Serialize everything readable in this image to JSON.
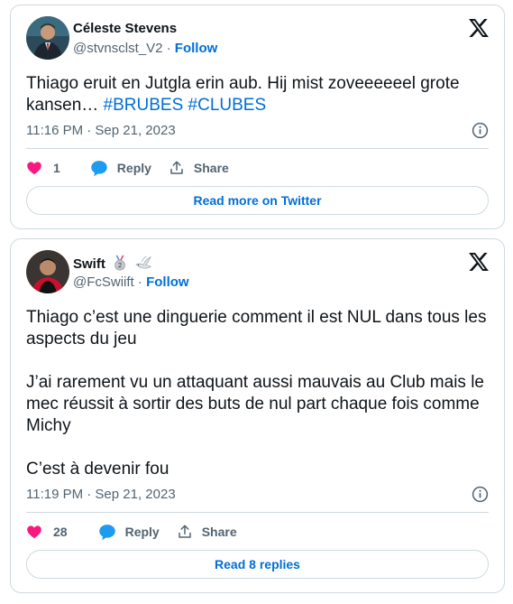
{
  "tweets": [
    {
      "author_name": "Céleste Stevens",
      "handle": "@stvnsclst_V2",
      "separator": "·",
      "follow_label": "Follow",
      "text_plain": "Thiago eruit en Jutgla erin aub. Hij mist zoveeeeeel grote kansen… ",
      "hashtags": [
        "#BRUBES",
        "#CLUBES"
      ],
      "timestamp": "11:16 PM · Sep 21, 2023",
      "likes": "1",
      "reply_label": "Reply",
      "share_label": "Share",
      "cta_label": "Read more on Twitter"
    },
    {
      "author_name": "Swift",
      "handle": "@FcSwiift",
      "separator": "·",
      "follow_label": "Follow",
      "paragraphs": [
        "Thiago c’est une dinguerie comment il est NUL dans tous les aspects du jeu",
        "J’ai rarement vu un attaquant aussi mauvais au Club mais le mec réussit à sortir des buts de nul part chaque fois comme Michy",
        "C’est à devenir fou"
      ],
      "timestamp": "11:19 PM · Sep 21, 2023",
      "likes": "28",
      "reply_label": "Reply",
      "share_label": "Share",
      "cta_label": "Read 8 replies"
    }
  ],
  "icons": {
    "brand": "x-logo-icon",
    "info": "info-icon",
    "like": "heart-icon",
    "reply": "speech-bubble-icon",
    "share": "share-arrow-icon",
    "name_emojis": [
      "second-place-medal-icon",
      "dove-icon"
    ]
  },
  "colors": {
    "link": "#006fd6",
    "text": "#0f1419",
    "secondary": "#536471",
    "like": "#f91880",
    "reply": "#1d9bf0",
    "border": "#cfd9de"
  }
}
